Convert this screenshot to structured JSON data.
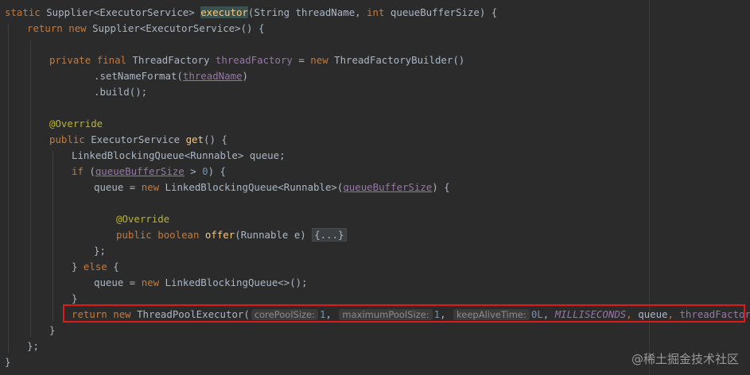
{
  "code": {
    "l1": {
      "static": "static",
      "type": " Supplier<ExecutorService> ",
      "name": "executor",
      "params_a": "(String threadName, ",
      "int": "int",
      "params_b": " queueBufferSize) {"
    },
    "l2": {
      "ret": "return",
      "sp": " ",
      "new": "new",
      "rest": " Supplier<ExecutorService>() {"
    },
    "l3": {
      "private": "private",
      "final": "final",
      "type": " ThreadFactory ",
      "field": "threadFactory",
      "eq": " = ",
      "new": "new",
      "rest": " ThreadFactoryBuilder()"
    },
    "l4": {
      "a": ".setNameFormat(",
      "u": "threadName",
      "b": ")"
    },
    "l5": {
      "text": ".build();"
    },
    "l6": {
      "ann": "@Override"
    },
    "l7": {
      "public": "public",
      "type": " ExecutorService ",
      "fn": "get",
      "rest": "() {"
    },
    "l8": {
      "text": "LinkedBlockingQueue<Runnable> queue;"
    },
    "l9": {
      "if": "if",
      "a": " (",
      "u": "queueBufferSize",
      "b": " > ",
      "num": "0",
      "c": ") {"
    },
    "l10": {
      "a": "queue = ",
      "new": "new",
      "b": " LinkedBlockingQueue<Runnable>(",
      "u": "queueBufferSize",
      "c": ") {"
    },
    "l11": {
      "ann": "@Override"
    },
    "l12": {
      "public": "public",
      "bool": "boolean",
      "fn": "offer",
      "a": "(Runnable e) ",
      "fold": "{...}"
    },
    "l13": {
      "text": "};"
    },
    "l14": {
      "a": "} ",
      "else": "else",
      "b": " {"
    },
    "l15": {
      "a": "queue = ",
      "new": "new",
      "b": " LinkedBlockingQueue<>();"
    },
    "l16": {
      "text": "}"
    },
    "l17": {
      "ret": "return",
      "new": "new",
      "a": " ThreadPoolExecutor(",
      "hint1": "corePoolSize:",
      "v1": "1",
      "hint2": "maximumPoolSize:",
      "v2": "1",
      "hint3": "keepAliveTime:",
      "v3": "0L",
      "ms": "MILLISECONDS",
      "q": "queue",
      "tf": "threadFactory",
      "end": ");"
    },
    "l18": {
      "text": "}"
    },
    "l19": {
      "text": "};"
    },
    "l20": {
      "text": "}"
    }
  },
  "watermark": "@稀土掘金技术社区",
  "colors": {
    "background": "#2b2b2b",
    "keyword": "#cc7832",
    "function": "#ffc66d",
    "field": "#9876aa",
    "number": "#6897bb",
    "annotation": "#bbb529",
    "highlight_border": "#e0191b"
  }
}
